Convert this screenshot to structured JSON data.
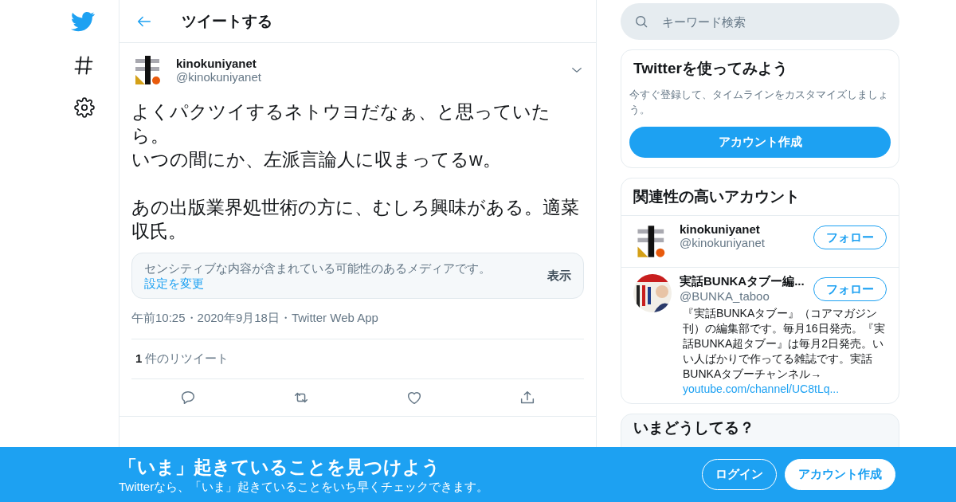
{
  "nav": [
    {
      "kind": "logo"
    },
    {
      "kind": "hashtag"
    },
    {
      "kind": "settings"
    }
  ],
  "header": {
    "title": "ツイートする"
  },
  "tweet": {
    "name": "kinokuniyanet",
    "handle": "@kinokuniyanet",
    "paragraphs": [
      {
        "lines": [
          "よくパクツイするネトウヨだなぁ、と思っていたら。",
          "いつの間にか、左派言論人に収まってるw。"
        ]
      },
      {
        "lines": [
          "あの出版業界処世術の方に、むしろ興味がある。適菜収氏。"
        ]
      }
    ],
    "notice": "センシティブな内容が含まれている可能性のあるメディアです。",
    "notice_link": "設定を変更",
    "notice_button": "表示",
    "meta": "午前10:25・2020年9月18日・Twitter Web App",
    "retweet_count": "1",
    "retweet_label": "件のリツイート",
    "actions": [
      {
        "kind": "reply"
      },
      {
        "kind": "retweet"
      },
      {
        "kind": "like"
      },
      {
        "kind": "share"
      }
    ]
  },
  "search": {
    "placeholder": "キーワード検索"
  },
  "signup_card": {
    "title": "Twitterを使ってみよう",
    "text": "今すぐ登録して、タイムラインをカスタマイズしましょう。",
    "button": "アカウント作成"
  },
  "related": {
    "title": "関連性の高いアカウント",
    "accounts": [
      {
        "kind": "logo",
        "name": "kinokuniyanet",
        "handle": "@kinokuniyanet",
        "button": "フォロー"
      },
      {
        "kind": "picture",
        "name": "実話BUNKAタブー編...",
        "handle": "@BUNKA_taboo",
        "button": "フォロー",
        "bio": "『実話BUNKAタブー』（コアマガジン刊）の編集部です。毎月16日発売。『実話BUNKA超タブー』は毎月2日発売。いい人ばかりで作ってる雑誌です。実話BUNKAタブーチャンネル→",
        "link": "youtube.com/channel/UC8tLq..."
      }
    ]
  },
  "trends": {
    "title": "いまどうしてる？"
  },
  "banner": {
    "title": "「いま」起きていることを見つけよう",
    "text": "Twitterなら、「いま」起きていることをいち早くチェックできます。",
    "buttons": [
      {
        "label": "ログイン",
        "kind": "outline"
      },
      {
        "label": "アカウント作成",
        "kind": "filled"
      }
    ]
  }
}
